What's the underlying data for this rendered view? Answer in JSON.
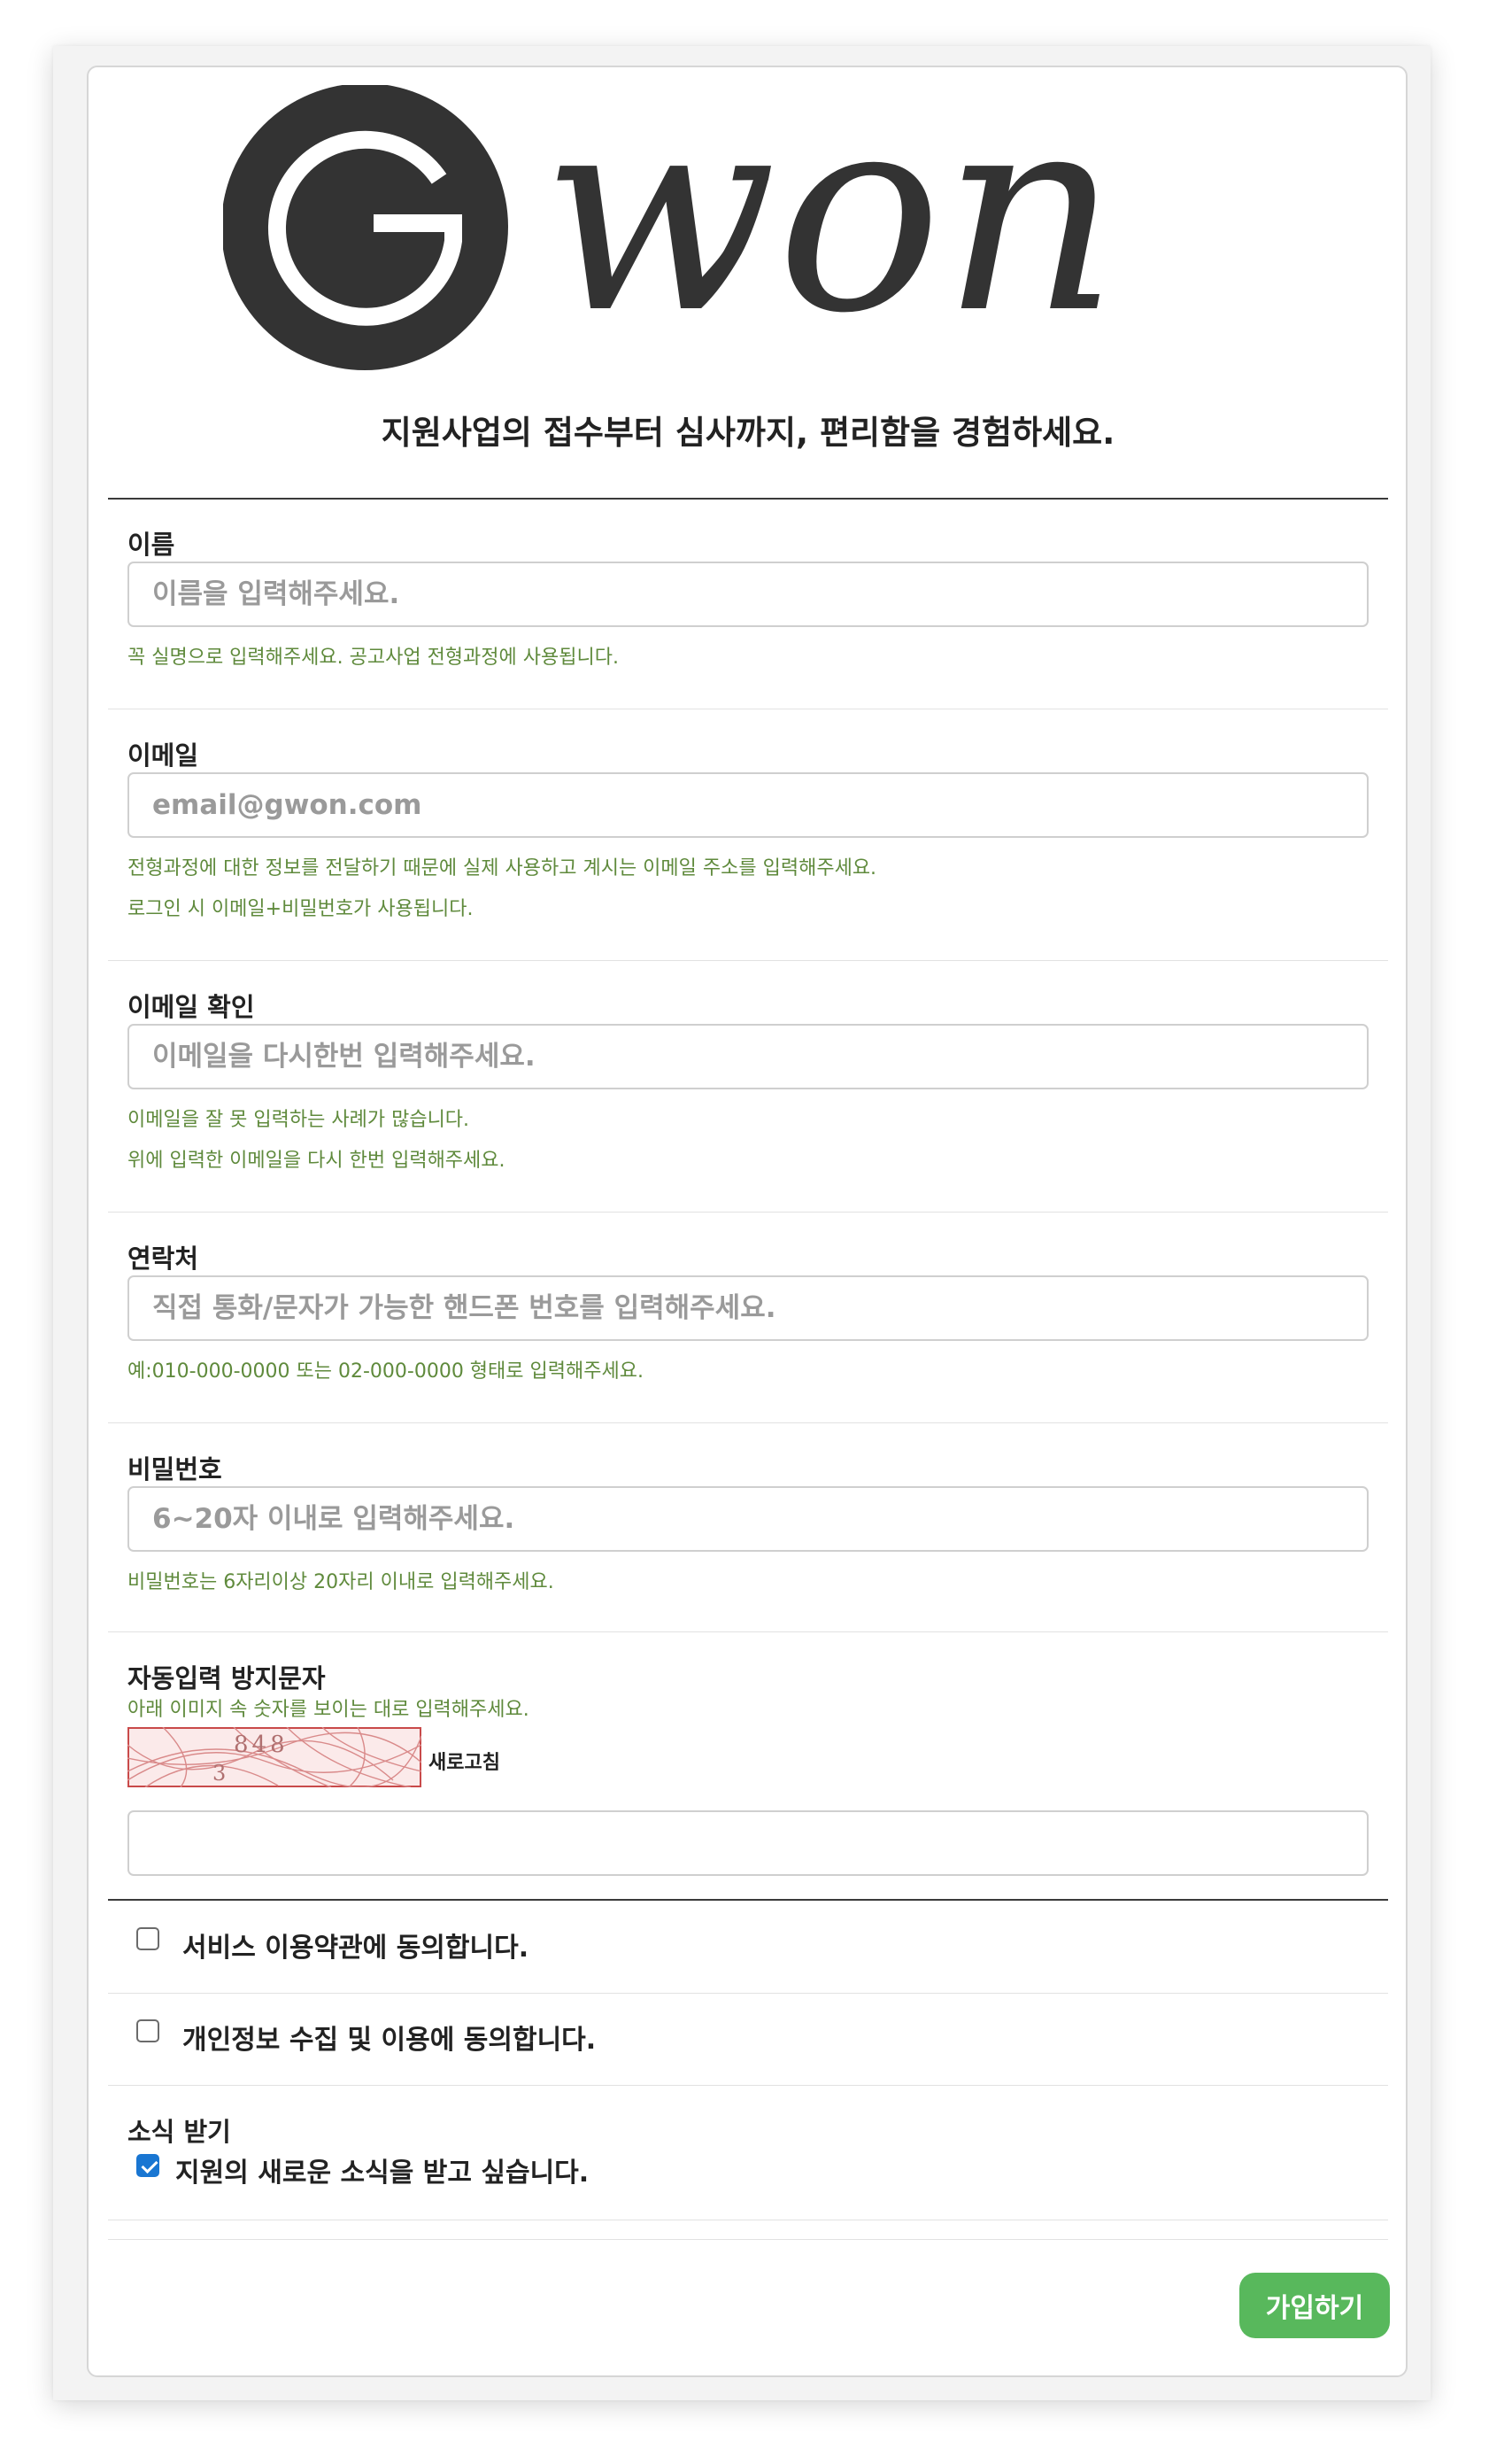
{
  "brand": {
    "logo_text": "won",
    "logo_letter": "G"
  },
  "tagline": "지원사업의 접수부터 심사까지, 편리함을 경험하세요.",
  "fields": {
    "name": {
      "label": "이름",
      "placeholder": "이름을 입력해주세요.",
      "help": [
        "꼭 실명으로 입력해주세요. 공고사업 전형과정에 사용됩니다."
      ]
    },
    "email": {
      "label": "이메일",
      "placeholder": "email@gwon.com",
      "help": [
        "전형과정에 대한 정보를 전달하기 때문에 실제 사용하고 계시는 이메일 주소를 입력해주세요.",
        "로그인 시 이메일+비밀번호가 사용됩니다."
      ]
    },
    "email_confirm": {
      "label": "이메일 확인",
      "placeholder": "이메일을 다시한번 입력해주세요.",
      "help": [
        "이메일을 잘 못 입력하는 사례가 많습니다.",
        "위에 입력한 이메일을 다시 한번 입력해주세요."
      ]
    },
    "phone": {
      "label": "연락처",
      "placeholder": "직접 통화/문자가 가능한 핸드폰 번호를 입력해주세요.",
      "help": [
        "예:010-000-0000 또는 02-000-0000 형태로 입력해주세요."
      ]
    },
    "password": {
      "label": "비밀번호",
      "placeholder": "6~20자 이내로 입력해주세요.",
      "help": [
        "비밀번호는 6자리이상 20자리 이내로 입력해주세요."
      ]
    }
  },
  "captcha": {
    "label": "자동입력 방지문자",
    "help": "아래 이미지 속 숫자를 보이는 대로 입력해주세요.",
    "image_text": "848",
    "image_text_2": "3",
    "refresh_label": "새로고침",
    "value": ""
  },
  "agreements": {
    "terms": {
      "label": "서비스 이용약관에 동의합니다.",
      "checked": false
    },
    "privacy": {
      "label": "개인정보 수집 및 이용에 동의합니다.",
      "checked": false
    }
  },
  "newsletter": {
    "title": "소식 받기",
    "label": "지원의 새로운 소식을 받고 싶습니다.",
    "checked": true
  },
  "submit_label": "가입하기",
  "colors": {
    "accent_green": "#58b85c",
    "help_text": "#5f8a3c",
    "logo_dark": "#333333",
    "checkbox_blue": "#1976d2"
  }
}
